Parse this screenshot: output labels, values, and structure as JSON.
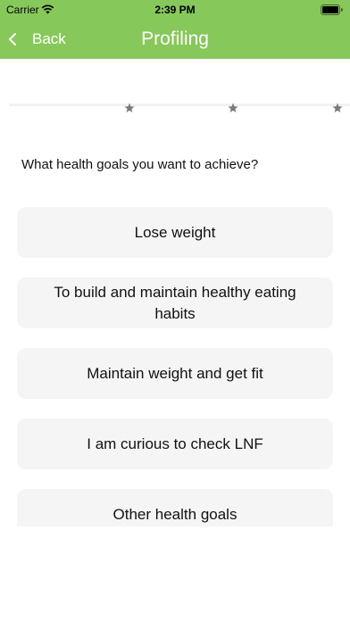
{
  "status_bar": {
    "carrier": "Carrier",
    "time": "2:39 PM"
  },
  "nav": {
    "back_label": "Back",
    "title": "Profiling",
    "color": "#87c85a"
  },
  "progress": {
    "star_count": 3
  },
  "question": "What health goals you want to achieve?",
  "options": [
    {
      "label": "Lose weight"
    },
    {
      "label": "To build and maintain healthy eating habits"
    },
    {
      "label": "Maintain weight and get fit"
    },
    {
      "label": "I am curious to check LNF"
    },
    {
      "label": "Other health goals"
    }
  ]
}
